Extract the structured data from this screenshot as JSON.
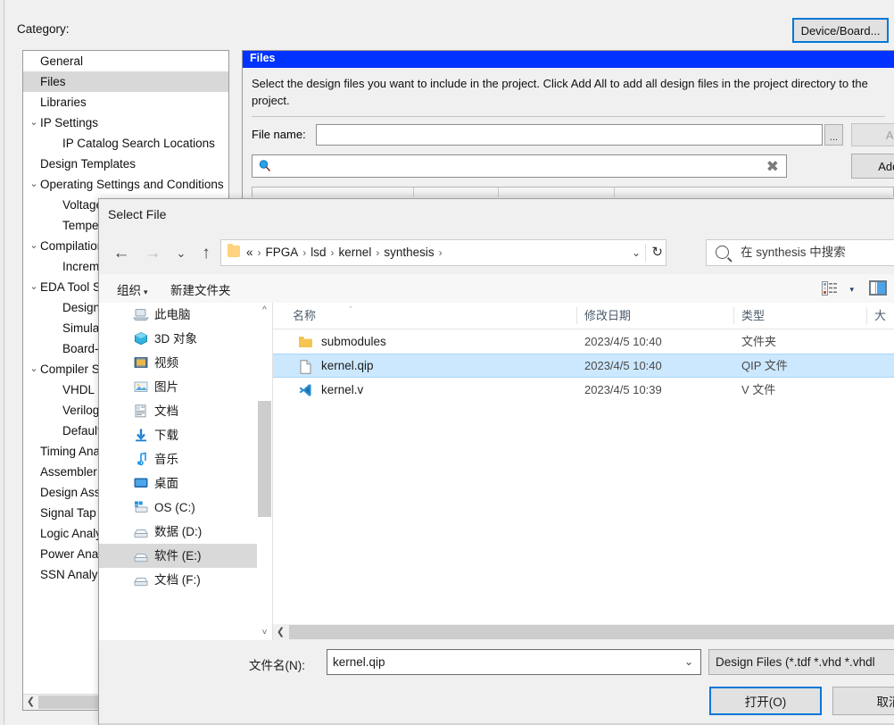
{
  "quartus": {
    "category_label": "Category:",
    "device_board_button": "Device/Board...",
    "tree": [
      {
        "label": "General",
        "level": 0,
        "chevron": "",
        "selected": false
      },
      {
        "label": "Files",
        "level": 0,
        "chevron": "",
        "selected": true
      },
      {
        "label": "Libraries",
        "level": 0,
        "chevron": "",
        "selected": false
      },
      {
        "label": "IP Settings",
        "level": 0,
        "chevron": "⌄",
        "selected": false
      },
      {
        "label": "IP Catalog Search Locations",
        "level": 1,
        "chevron": "",
        "selected": false
      },
      {
        "label": "Design Templates",
        "level": 0,
        "chevron": "",
        "selected": false
      },
      {
        "label": "Operating Settings and Conditions",
        "level": 0,
        "chevron": "⌄",
        "selected": false
      },
      {
        "label": "Voltage",
        "level": 1,
        "chevron": "",
        "selected": false
      },
      {
        "label": "Temperature",
        "level": 1,
        "chevron": "",
        "selected": false
      },
      {
        "label": "Compilation Process Settings",
        "level": 0,
        "chevron": "⌄",
        "selected": false
      },
      {
        "label": "Incremental Compilation",
        "level": 1,
        "chevron": "",
        "selected": false
      },
      {
        "label": "EDA Tool Settings",
        "level": 0,
        "chevron": "⌄",
        "selected": false
      },
      {
        "label": "Design Entry/Synthesis",
        "level": 1,
        "chevron": "",
        "selected": false
      },
      {
        "label": "Simulation",
        "level": 1,
        "chevron": "",
        "selected": false
      },
      {
        "label": "Board-Level",
        "level": 1,
        "chevron": "",
        "selected": false
      },
      {
        "label": "Compiler Settings",
        "level": 0,
        "chevron": "⌄",
        "selected": false
      },
      {
        "label": "VHDL Input",
        "level": 1,
        "chevron": "",
        "selected": false
      },
      {
        "label": "Verilog HDL Input",
        "level": 1,
        "chevron": "",
        "selected": false
      },
      {
        "label": "Default Parameters",
        "level": 1,
        "chevron": "",
        "selected": false
      },
      {
        "label": "Timing Analyzer",
        "level": 0,
        "chevron": "",
        "selected": false
      },
      {
        "label": "Assembler",
        "level": 0,
        "chevron": "",
        "selected": false
      },
      {
        "label": "Design Assistant",
        "level": 0,
        "chevron": "",
        "selected": false
      },
      {
        "label": "Signal Tap Logic Analyzer",
        "level": 0,
        "chevron": "",
        "selected": false
      },
      {
        "label": "Logic Analyzer Interface",
        "level": 0,
        "chevron": "",
        "selected": false
      },
      {
        "label": "Power Analyzer Settings",
        "level": 0,
        "chevron": "",
        "selected": false
      },
      {
        "label": "SSN Analyzer",
        "level": 0,
        "chevron": "",
        "selected": false
      }
    ],
    "files_panel": {
      "title": "Files",
      "description": "Select the design files you want to include in the project. Click Add All to add all design files in the project directory to the project.",
      "file_name_label": "File name:",
      "file_name_value": "",
      "browse_button": "...",
      "add_button": "Add",
      "add_all_button": "Add All",
      "search_value": "",
      "search_icon": "search-icon",
      "clear_icon": "✖"
    }
  },
  "dialog": {
    "title": "Select File",
    "nav": {
      "back": "←",
      "forward": "→",
      "recent": "⌄",
      "up": "↑",
      "path_prefix": "«",
      "path_segments": [
        "FPGA",
        "lsd",
        "kernel",
        "synthesis"
      ],
      "path_separator": "›",
      "dropdown_chevron": "⌄",
      "refresh": "↻",
      "search_placeholder": "在 synthesis 中搜索"
    },
    "toolbar": {
      "organize": "组织",
      "organize_caret": "▾",
      "new_folder": "新建文件夹",
      "view_caret": "▾"
    },
    "nav_pane": [
      {
        "label": "此电脑",
        "icon": "computer-icon",
        "selected": false
      },
      {
        "label": "3D 对象",
        "icon": "3d-objects-icon",
        "selected": false
      },
      {
        "label": "视频",
        "icon": "videos-icon",
        "selected": false
      },
      {
        "label": "图片",
        "icon": "pictures-icon",
        "selected": false
      },
      {
        "label": "文档",
        "icon": "documents-icon",
        "selected": false
      },
      {
        "label": "下载",
        "icon": "downloads-icon",
        "selected": false
      },
      {
        "label": "音乐",
        "icon": "music-icon",
        "selected": false
      },
      {
        "label": "桌面",
        "icon": "desktop-icon",
        "selected": false
      },
      {
        "label": "OS (C:)",
        "icon": "windows-drive-icon",
        "selected": false
      },
      {
        "label": "数据 (D:)",
        "icon": "drive-icon",
        "selected": false
      },
      {
        "label": "软件 (E:)",
        "icon": "drive-icon",
        "selected": true
      },
      {
        "label": "文档 (F:)",
        "icon": "drive-icon",
        "selected": false
      }
    ],
    "file_list": {
      "columns": [
        "名称",
        "修改日期",
        "类型",
        "大"
      ],
      "sort_arrow": "＾",
      "rows": [
        {
          "name": "submodules",
          "date": "2023/4/5 10:40",
          "type": "文件夹",
          "icon": "folder-icon",
          "selected": false
        },
        {
          "name": "kernel.qip",
          "date": "2023/4/5 10:40",
          "type": "QIP 文件",
          "icon": "generic-file-icon",
          "selected": true
        },
        {
          "name": "kernel.v",
          "date": "2023/4/5 10:39",
          "type": "V 文件",
          "icon": "vscode-file-icon",
          "selected": false
        }
      ]
    },
    "bottom": {
      "file_name_label": "文件名(N):",
      "file_name_value": "kernel.qip",
      "file_name_chevron": "⌄",
      "file_type_value": "Design Files (*.tdf *.vhd *.vhdl",
      "open_button": "打开(O)",
      "cancel_button": "取消"
    }
  }
}
